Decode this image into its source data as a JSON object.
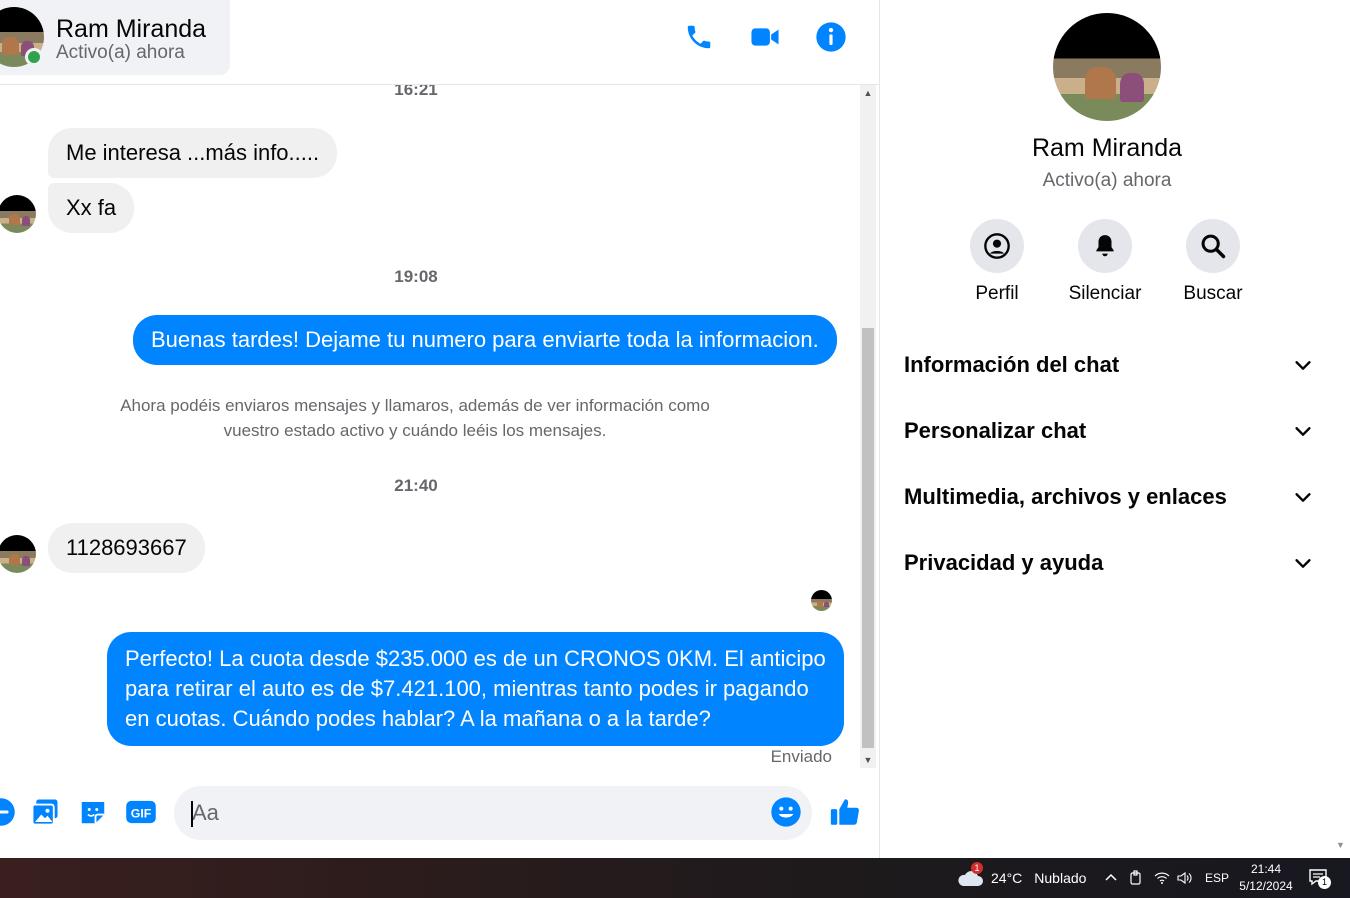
{
  "header": {
    "contact_name": "Ram Miranda",
    "status": "Activo(a) ahora",
    "icons": [
      "phone-icon",
      "video-camera-icon",
      "info-icon"
    ]
  },
  "messages": {
    "time_1": "16:21",
    "in_1": "Me interesa ...más info.....",
    "in_2": "Xx fa",
    "time_2": "19:08",
    "out_1": "Buenas tardes! Dejame tu numero para enviarte toda la informacion.",
    "system_note_line1": "Ahora podéis enviaros mensajes y llamaros, además de ver información como",
    "system_note_line2": "vuestro estado activo y cuándo leéis los mensajes.",
    "time_3": "21:40",
    "in_3": "1128693667",
    "out_2_line1": "Perfecto! La cuota desde $235.000 es de un CRONOS 0KM. El anticipo",
    "out_2_line2": "para retirar el auto es de $7.421.100, mientras tanto podes ir pagando",
    "out_2_line3": "en cuotas. Cuándo podes hablar? A la mañana o a la tarde?",
    "sent_status": "Enviado"
  },
  "composer": {
    "placeholder": "Aa",
    "icons": [
      "plus-icon",
      "image-icon",
      "sticker-icon",
      "gif-icon",
      "emoji-icon",
      "like-icon"
    ]
  },
  "right_panel": {
    "name": "Ram Miranda",
    "status": "Activo(a) ahora",
    "actions": [
      {
        "label": "Perfil",
        "icon": "profile-icon"
      },
      {
        "label": "Silenciar",
        "icon": "bell-icon"
      },
      {
        "label": "Buscar",
        "icon": "search-icon"
      }
    ],
    "sections": [
      {
        "label": "Información del chat"
      },
      {
        "label": "Personalizar chat"
      },
      {
        "label": "Multimedia, archivos y enlaces"
      },
      {
        "label": "Privacidad y ayuda"
      }
    ]
  },
  "taskbar": {
    "weather_badge": "1",
    "weather_temp": "24°C",
    "weather_text": "Nublado",
    "language": "ESP",
    "time": "21:44",
    "date": "5/12/2024",
    "notification_count": "1"
  },
  "colors": {
    "accent": "#0084ff",
    "incoming_bubble": "#f0f0f0",
    "online": "#31a24c"
  }
}
